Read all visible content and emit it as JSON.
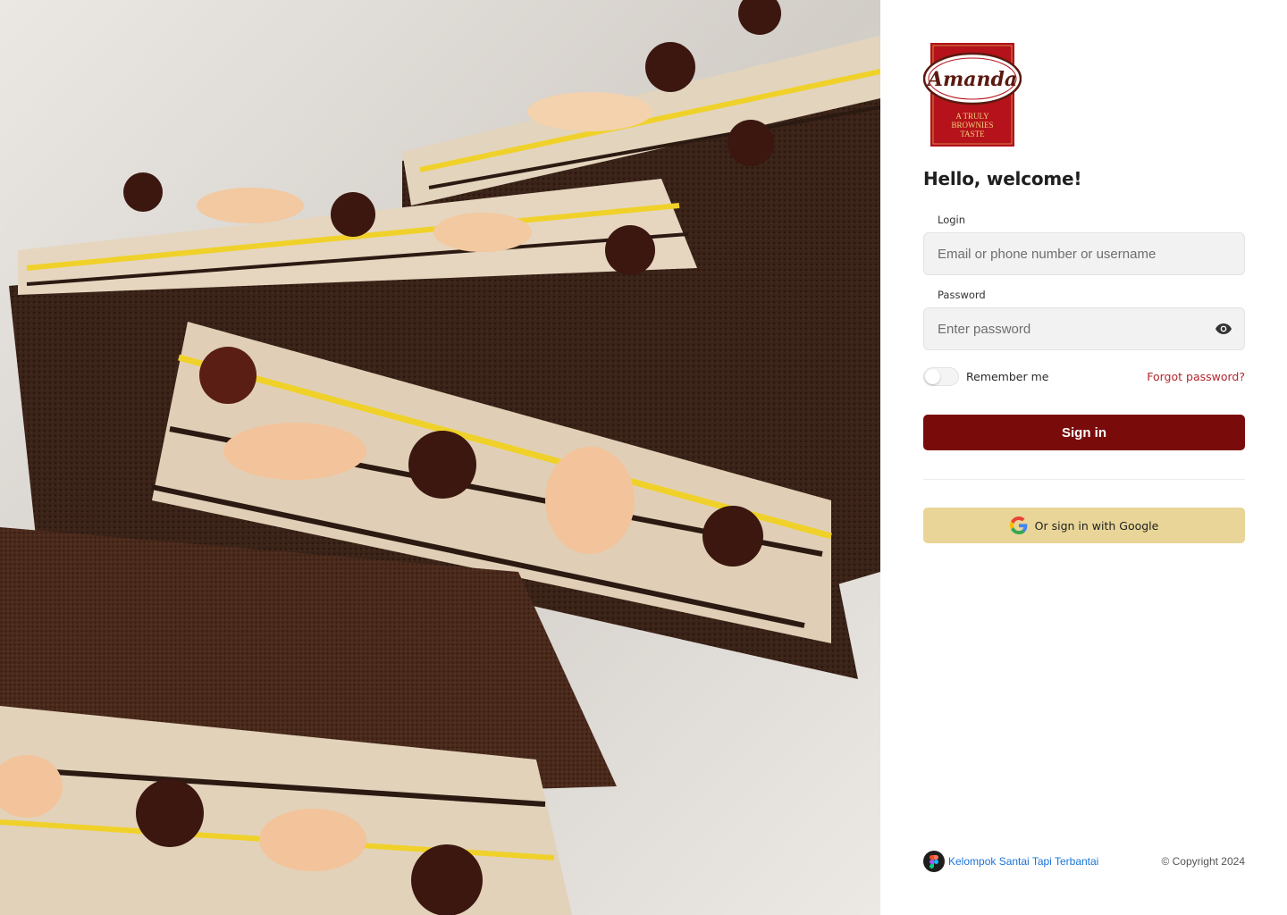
{
  "brand": {
    "logo_name": "Amanda",
    "logo_tagline_lines": [
      "A TRULY",
      "BROWNIES",
      "TASTE"
    ],
    "logo_bg_color": "#b5121b",
    "logo_oval_color": "#ffffff"
  },
  "hero": {
    "image_subject": "brownie-cake-slices",
    "icon": "hero-image"
  },
  "form": {
    "heading": "Hello, welcome!",
    "login_label": "Login",
    "login_placeholder": "Email or phone number or username",
    "login_value": "",
    "password_label": "Password",
    "password_placeholder": "Enter password",
    "password_value": "",
    "show_password_icon": "eye-icon",
    "remember_label": "Remember me",
    "remember_checked": false,
    "forgot_label": "Forgot password?",
    "signin_label": "Sign in",
    "google_label": "Or sign in with Google",
    "google_icon": "google-icon"
  },
  "footer": {
    "brand_icon": "figma-icon",
    "brand_text": "Kelompok Santai Tapi Terbantai",
    "copyright": "© Copyright 2024"
  },
  "colors": {
    "primary": "#7a0b0b",
    "google_button": "#e8d597",
    "link_red": "#b3272d",
    "link_blue": "#1b74d8"
  }
}
